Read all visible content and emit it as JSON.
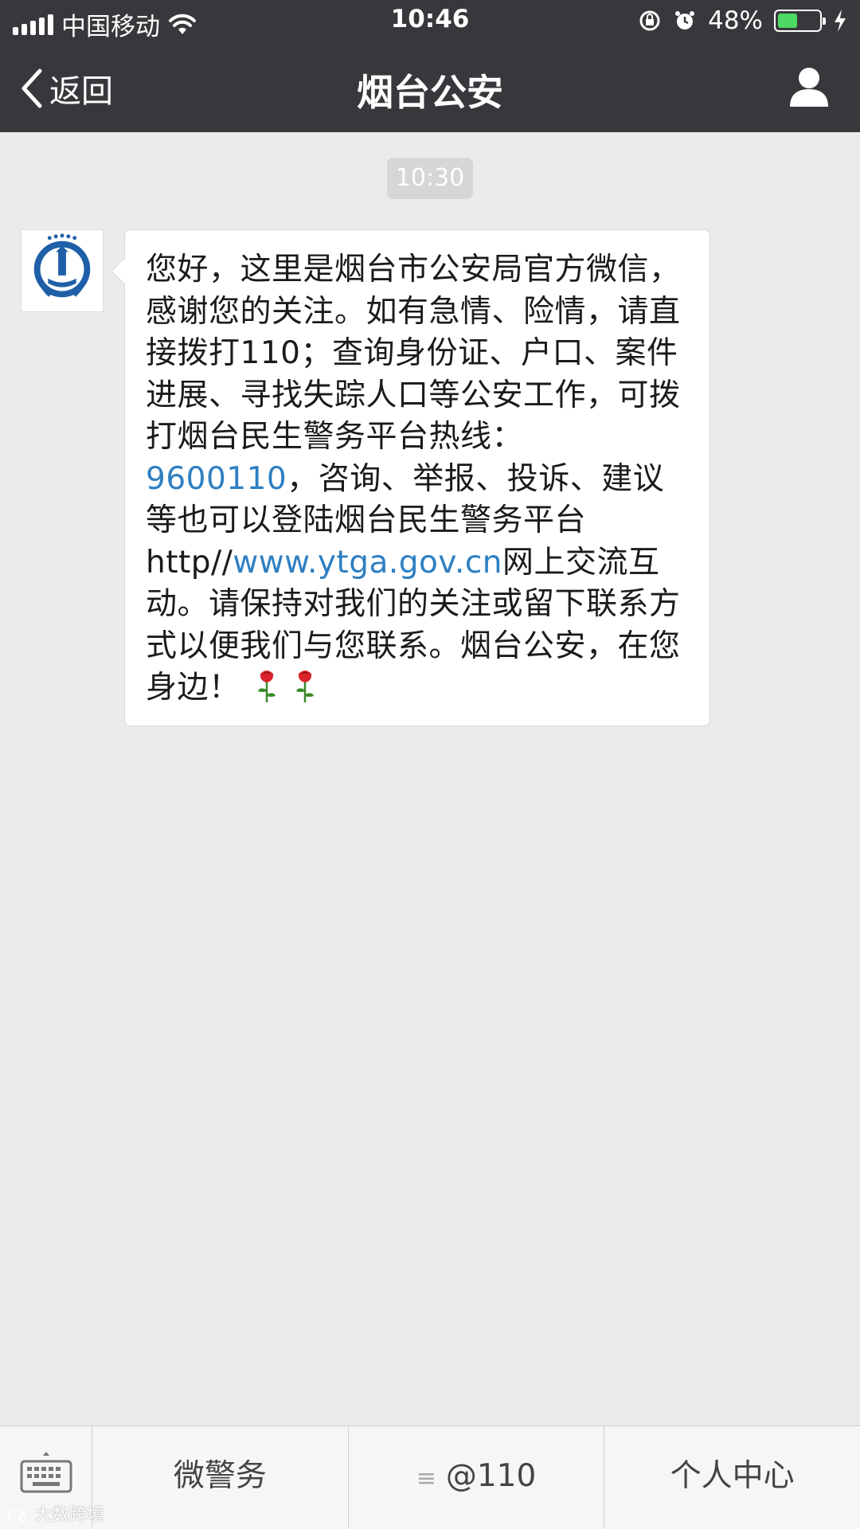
{
  "status_bar": {
    "carrier": "中国移动",
    "time": "10:46",
    "battery": "48%",
    "battery_level": 0.48
  },
  "nav": {
    "back_label": "返回",
    "title": "烟台公安"
  },
  "chat": {
    "timestamp": "10:30",
    "message": {
      "line1": "您好，这里是烟台市公安局官方微信，感谢您的关注。如有急情、险情，请直接拨打110；查询身份证、户口、案件进展、寻找失踪人口等公安工作，可拨打烟台民生警务平台热线：",
      "phone": "9600110",
      "line2": "，咨询、举报、投诉、建议等也可以登陆烟台民生警务平台http//",
      "url": "www.ytga.gov.cn",
      "line3": "网上交流互动。请保持对我们的关注或留下联系方式以便我们与您联系。烟台公安，在您身边！"
    }
  },
  "bottom_bar": {
    "tab1": "微警务",
    "tab2": "@110",
    "tab3": "个人中心"
  },
  "watermark": "大数跨境",
  "colors": {
    "header_bg": "#38383c",
    "chat_bg": "#ebebeb",
    "link": "#2e7fc2",
    "battery": "#4cd964"
  }
}
